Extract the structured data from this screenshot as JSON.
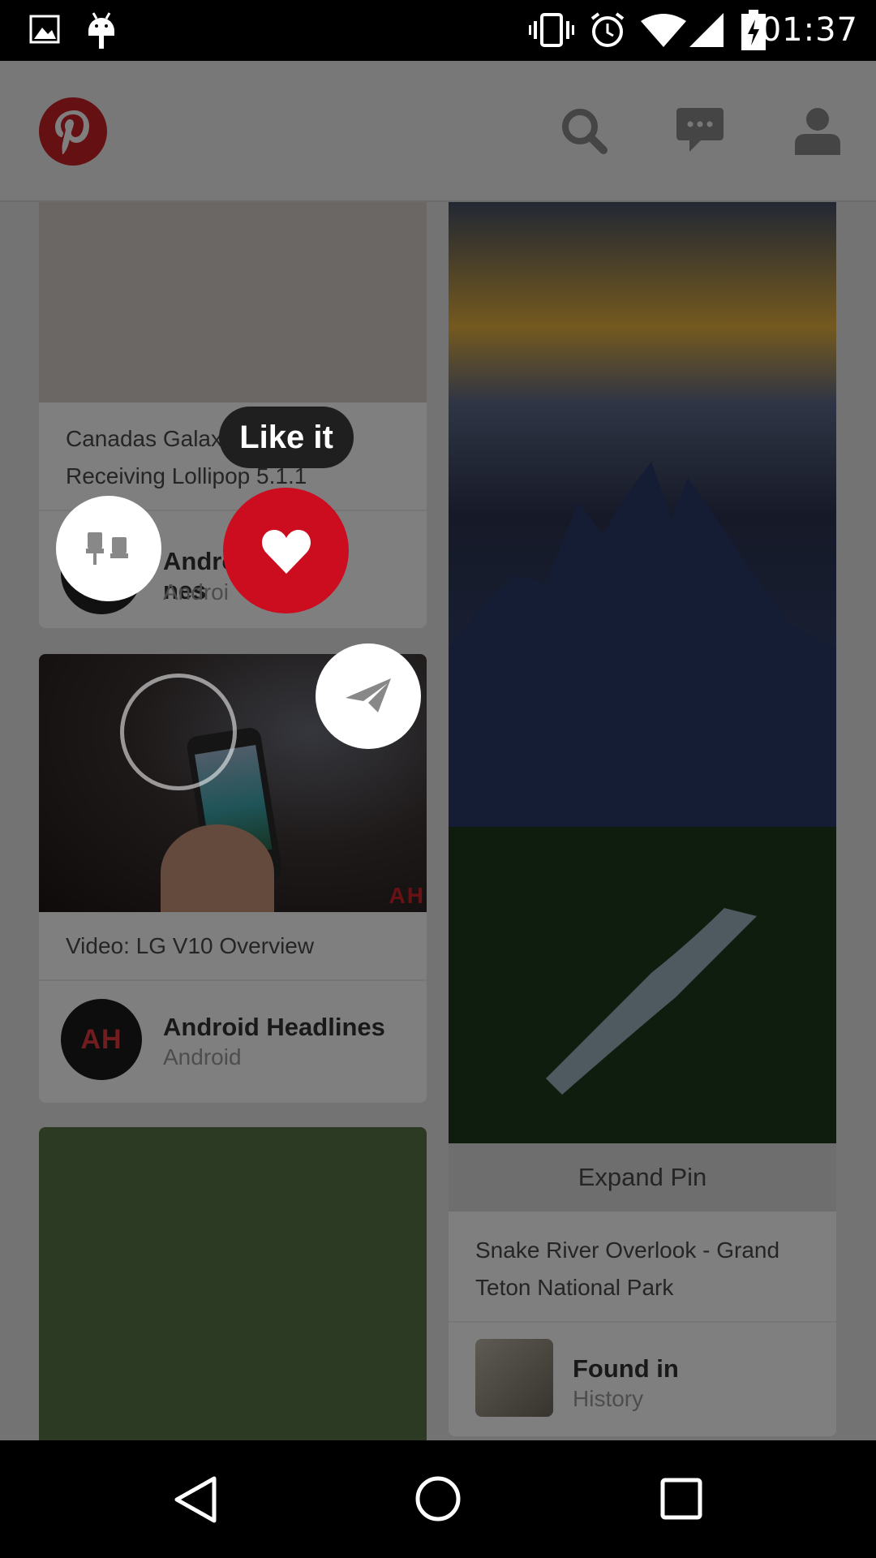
{
  "status_bar": {
    "time": "01:37",
    "icons": [
      "image-icon",
      "android-icon",
      "vibrate-icon",
      "alarm-icon",
      "wifi-icon",
      "signal-icon",
      "battery-charging-icon"
    ]
  },
  "header": {
    "logo": "pinterest-logo",
    "actions": [
      "search-icon",
      "messages-icon",
      "profile-icon"
    ]
  },
  "feed": {
    "left_column": [
      {
        "description": "Canadas Galaxy S6 Receiving Lollipop 5.1.1",
        "description_line1": "Canadas Galaxy",
        "description_line2": "Receiving Lollipop 5.1.1",
        "pinner_name": "Android Headlines",
        "pinner_name_visible": "Andro",
        "pinner_name_tail": "nes",
        "board": "Android",
        "board_visible": "Androi"
      },
      {
        "image_watermark": "AH",
        "description": "Video: LG V10 Overview",
        "avatar_text": "AH",
        "pinner_name": "Android Headlines",
        "board": "Android"
      },
      {
        "image_color": "#5b7447"
      }
    ],
    "right_column": [
      {
        "expand_label": "Expand Pin",
        "description_line1": "Snake River Overlook - Grand",
        "description_line2": "Teton National Park",
        "found_in_label": "Found in",
        "board": "History"
      }
    ]
  },
  "overlay": {
    "tooltip": "Like it",
    "actions": [
      {
        "name": "pin-it",
        "icon": "pushpin-icon"
      },
      {
        "name": "like-it",
        "icon": "heart-icon",
        "color": "#cb0d1f"
      },
      {
        "name": "send",
        "icon": "paper-plane-icon"
      }
    ]
  },
  "nav_bar": {
    "buttons": [
      "back-icon",
      "home-icon",
      "recents-icon"
    ]
  },
  "colors": {
    "brand": "#cb2027",
    "like": "#cb0d1f"
  }
}
